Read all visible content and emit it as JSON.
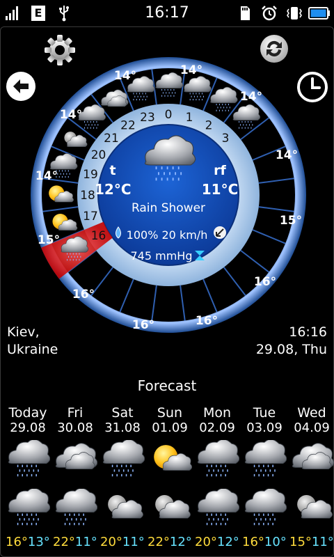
{
  "status_bar": {
    "time": "16:17",
    "network_label": "E"
  },
  "location": {
    "city": "Kiev,",
    "country": "Ukraine"
  },
  "datetime": {
    "time": "16:16",
    "date": "29.08, Thu"
  },
  "current": {
    "t_label": "t",
    "rf_label": "rf",
    "temperature": "12°C",
    "real_feel": "11°C",
    "condition": "Rain Shower",
    "wind": "100% 20 km/h",
    "pressure": "745 mmHg"
  },
  "dial": {
    "hours": [
      "0",
      "1",
      "2",
      "3",
      "16",
      "17",
      "18",
      "19",
      "20",
      "21",
      "22",
      "23"
    ],
    "temps": [
      "14°",
      "14°",
      "14°",
      "14°",
      "14°",
      "15°",
      "16°",
      "16°",
      "16°",
      "16°",
      "15°",
      "14°",
      "14°"
    ],
    "highlighted_hour": "16"
  },
  "forecast": {
    "title": "Forecast",
    "days": [
      {
        "name": "Today",
        "date": "29.08",
        "high": "16°",
        "low": "13°",
        "day_icon": "rain-cloud-icon",
        "night_icon": "rain-cloud-icon"
      },
      {
        "name": "Fri",
        "date": "30.08",
        "high": "22°",
        "low": "11°",
        "day_icon": "cloud-icon",
        "night_icon": "rain-cloud-icon"
      },
      {
        "name": "Sat",
        "date": "31.08",
        "high": "20°",
        "low": "11°",
        "day_icon": "rain-cloud-icon",
        "night_icon": "moon-cloud-icon"
      },
      {
        "name": "Sun",
        "date": "01.09",
        "high": "22°",
        "low": "12°",
        "day_icon": "sun-cloud-icon",
        "night_icon": "moon-cloud-icon"
      },
      {
        "name": "Mon",
        "date": "02.09",
        "high": "20°",
        "low": "12°",
        "day_icon": "rain-cloud-icon",
        "night_icon": "rain-cloud-icon"
      },
      {
        "name": "Tue",
        "date": "03.09",
        "high": "16°",
        "low": "10°",
        "day_icon": "rain-cloud-icon",
        "night_icon": "rain-cloud-icon"
      },
      {
        "name": "Wed",
        "date": "04.09",
        "high": "15°",
        "low": "11°",
        "day_icon": "cloud-icon",
        "night_icon": "moon-cloud-icon"
      }
    ]
  }
}
